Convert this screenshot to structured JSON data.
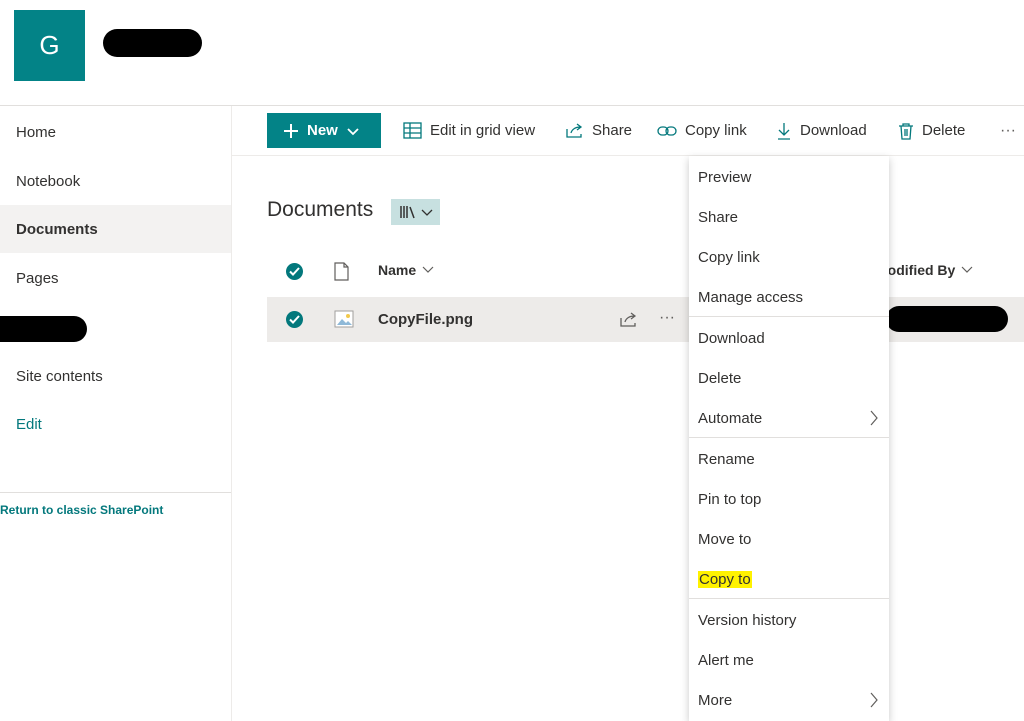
{
  "site": {
    "logo_letter": "G"
  },
  "nav": {
    "items": [
      "Home",
      "Notebook",
      "Documents",
      "Pages",
      "Site contents",
      "Edit"
    ],
    "selected": "Documents",
    "classic_link": "Return to classic SharePoint"
  },
  "commands": {
    "new": "New",
    "edit_grid": "Edit in grid view",
    "share": "Share",
    "copy_link": "Copy link",
    "download": "Download",
    "delete": "Delete",
    "more": "···"
  },
  "library": {
    "title": "Documents",
    "columns": {
      "name": "Name",
      "modified_by": "Modified By"
    },
    "rows": [
      {
        "name": "CopyFile.png",
        "more": "···"
      }
    ]
  },
  "context_menu": {
    "items": [
      "Preview",
      "Share",
      "Copy link",
      "Manage access",
      "Download",
      "Delete",
      "Automate",
      "Rename",
      "Pin to top",
      "Move to",
      "Copy to",
      "Version history",
      "Alert me",
      "More"
    ],
    "highlighted": "Copy to"
  },
  "colors": {
    "accent": "#038387",
    "link": "#03787c",
    "highlight": "#fff200"
  }
}
